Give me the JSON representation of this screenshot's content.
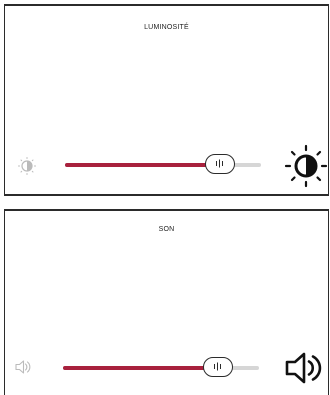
{
  "brightness": {
    "title": "LUMINOSITÉ",
    "level": 0.79,
    "min_icon": "brightness-low-icon",
    "max_icon": "brightness-high-icon"
  },
  "sound": {
    "title": "SON",
    "level": 0.79,
    "min_icon": "volume-low-icon",
    "max_icon": "volume-high-icon"
  },
  "colors": {
    "accent": "#a8213d",
    "track": "#d6d6d6",
    "outline": "#2b2b2b"
  }
}
